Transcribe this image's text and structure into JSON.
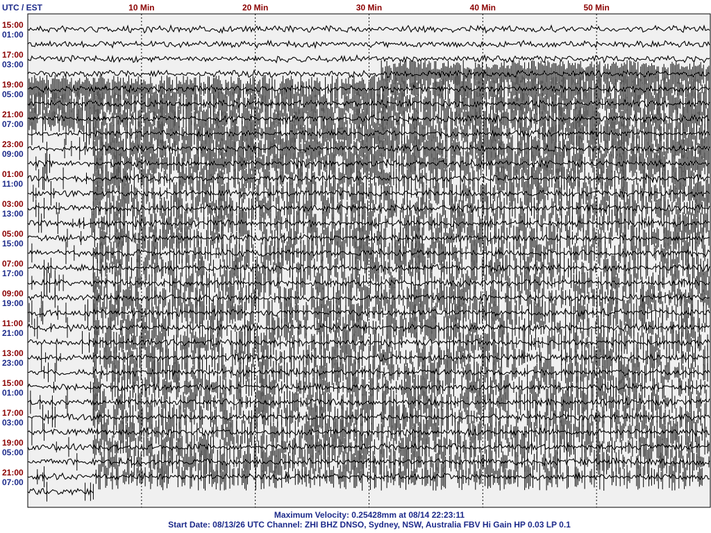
{
  "chart_data": {
    "type": "line",
    "title": "",
    "corner_label": "UTC / EST",
    "x_ticks": [
      {
        "minute": 10,
        "label": "10 Min"
      },
      {
        "minute": 20,
        "label": "20 Min"
      },
      {
        "minute": 30,
        "label": "30 Min"
      },
      {
        "minute": 40,
        "label": "40 Min"
      },
      {
        "minute": 50,
        "label": "50 Min"
      }
    ],
    "xlim": [
      0,
      60
    ],
    "grid": true,
    "row_labels": [
      {
        "utc": "15:00",
        "est": "01:00"
      },
      {
        "utc": "17:00",
        "est": "03:00"
      },
      {
        "utc": "19:00",
        "est": "05:00"
      },
      {
        "utc": "21:00",
        "est": "07:00"
      },
      {
        "utc": "23:00",
        "est": "09:00"
      },
      {
        "utc": "01:00",
        "est": "11:00"
      },
      {
        "utc": "03:00",
        "est": "13:00"
      },
      {
        "utc": "05:00",
        "est": "15:00"
      },
      {
        "utc": "07:00",
        "est": "17:00"
      },
      {
        "utc": "09:00",
        "est": "19:00"
      },
      {
        "utc": "11:00",
        "est": "21:00"
      },
      {
        "utc": "13:00",
        "est": "23:00"
      },
      {
        "utc": "15:00",
        "est": "01:00"
      },
      {
        "utc": "17:00",
        "est": "03:00"
      },
      {
        "utc": "19:00",
        "est": "05:00"
      },
      {
        "utc": "21:00",
        "est": "07:00"
      }
    ],
    "trace_rows": 32,
    "last_row_end_minute": 5.8,
    "event_onset_row": 3,
    "event_onset_minute": 31,
    "colors": {
      "utc": "#8b0000",
      "est": "#1c2a8a",
      "trace": "#000000",
      "background": "#f0f0f0"
    }
  },
  "footer": {
    "line1": "Maximum Velocity: 0.25428mm at 08/14 22:23:11",
    "line2": "Start Date: 08/13/26 UTC Channel: ZHI  BHZ  DNSO, Sydney, NSW, Australia  FBV Hi Gain HP 0.03  LP 0.1"
  }
}
